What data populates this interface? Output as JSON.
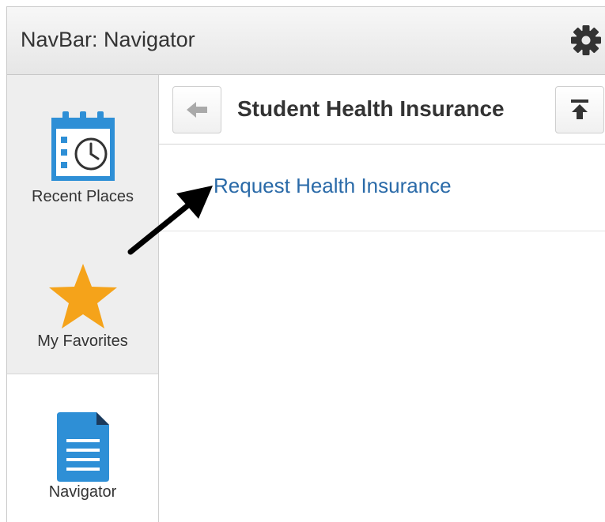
{
  "header": {
    "title": "NavBar: Navigator",
    "settings_icon": "gear-icon"
  },
  "sidebar": {
    "items": [
      {
        "label": "Recent Places",
        "icon": "calendar-clock-icon",
        "accent": "#2e8fd6"
      },
      {
        "label": "My Favorites",
        "icon": "star-icon",
        "accent": "#f5a31a"
      },
      {
        "label": "Navigator",
        "icon": "document-icon",
        "accent": "#2e8fd6",
        "selected": true
      }
    ]
  },
  "content": {
    "title": "Student Health Insurance",
    "back_icon": "arrow-left-icon",
    "top_icon": "arrow-up-to-top-icon",
    "items": [
      {
        "label": "Request Health Insurance",
        "color": "#2a6aa8"
      }
    ]
  },
  "annotation": {
    "icon": "pointer-arrow-icon",
    "color": "#000000"
  }
}
